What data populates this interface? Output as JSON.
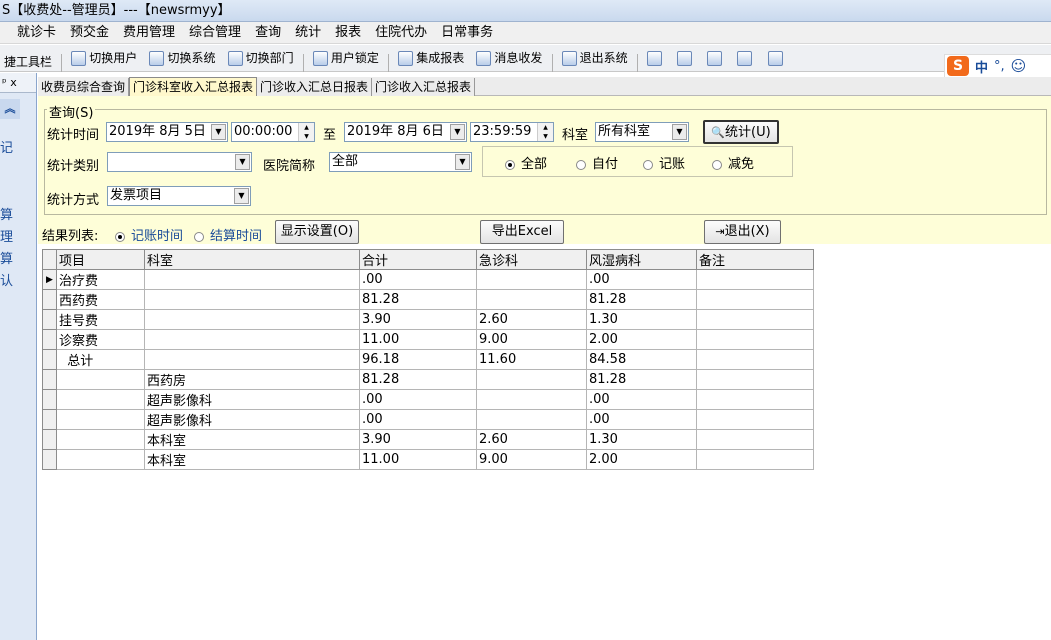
{
  "window": {
    "title": "S【收费处--管理员】---【newsrmyy】"
  },
  "menu": [
    "就诊卡",
    "预交金",
    "费用管理",
    "综合管理",
    "查询",
    "统计",
    "报表",
    "住院代办",
    "日常事务"
  ],
  "toolbar": {
    "quickbar_label": "捷工具栏",
    "items": [
      "切换用户",
      "切换系统",
      "切换部门",
      "用户锁定",
      "集成报表",
      "消息收发",
      "退出系统"
    ]
  },
  "ime": {
    "logo": "S",
    "mode": "中",
    "punct": "°,",
    "emoji": "☺"
  },
  "left_pane": {
    "pin": "ᵖ x",
    "items": [
      "记",
      "算",
      "理",
      "算",
      "认"
    ]
  },
  "tabs": [
    "收费员综合查询",
    "门诊科室收入汇总报表",
    "门诊收入汇总日报表",
    "门诊收入汇总报表"
  ],
  "active_tab": 1,
  "query": {
    "group_label": "查询(S)",
    "stat_time_label": "统计时间",
    "start_date": "2019年 8月 5日",
    "start_time": "00:00:00",
    "to_label": "至",
    "end_date": "2019年 8月 6日",
    "end_time": "23:59:59",
    "dept_label": "科室",
    "dept_value": "所有科室",
    "stat_button": "统计(U)",
    "category_label": "统计类别",
    "category_value": "",
    "hospital_label": "医院简称",
    "hospital_value": "全部",
    "pay_options": [
      "全部",
      "自付",
      "记账",
      "减免"
    ],
    "pay_selected": 0,
    "method_label": "统计方式",
    "method_value": "发票项目"
  },
  "result_bar": {
    "list_label": "结果列表:",
    "time_options": [
      "记账时间",
      "结算时间"
    ],
    "time_selected": 0,
    "display_settings_button": "显示设置(O)",
    "export_button": "导出Excel",
    "exit_button": "退出(X)"
  },
  "grid": {
    "columns": [
      "项目",
      "科室",
      "合计",
      "急诊科",
      "风湿病科",
      "备注"
    ],
    "rows": [
      [
        "治疗费",
        "",
        ".00",
        "",
        ".00",
        ""
      ],
      [
        "西药费",
        "",
        "81.28",
        "",
        "81.28",
        ""
      ],
      [
        "挂号费",
        "",
        "3.90",
        "2.60",
        "1.30",
        ""
      ],
      [
        "诊察费",
        "",
        "11.00",
        "9.00",
        "2.00",
        ""
      ],
      [
        "  总计",
        "",
        "96.18",
        "11.60",
        "84.58",
        ""
      ],
      [
        "",
        "西药房",
        "81.28",
        "",
        "81.28",
        ""
      ],
      [
        "",
        "超声影像科",
        ".00",
        "",
        ".00",
        ""
      ],
      [
        "",
        "超声影像科",
        ".00",
        "",
        ".00",
        ""
      ],
      [
        "",
        "本科室",
        "3.90",
        "2.60",
        "1.30",
        ""
      ],
      [
        "",
        "本科室",
        "11.00",
        "9.00",
        "2.00",
        ""
      ]
    ],
    "current_row": 0
  },
  "colors": {
    "filter_bg": "#fefed8",
    "active_tab_bg": "#fff8cc",
    "nav_text": "#1a4c99",
    "ime_accent": "#f26a1b"
  }
}
